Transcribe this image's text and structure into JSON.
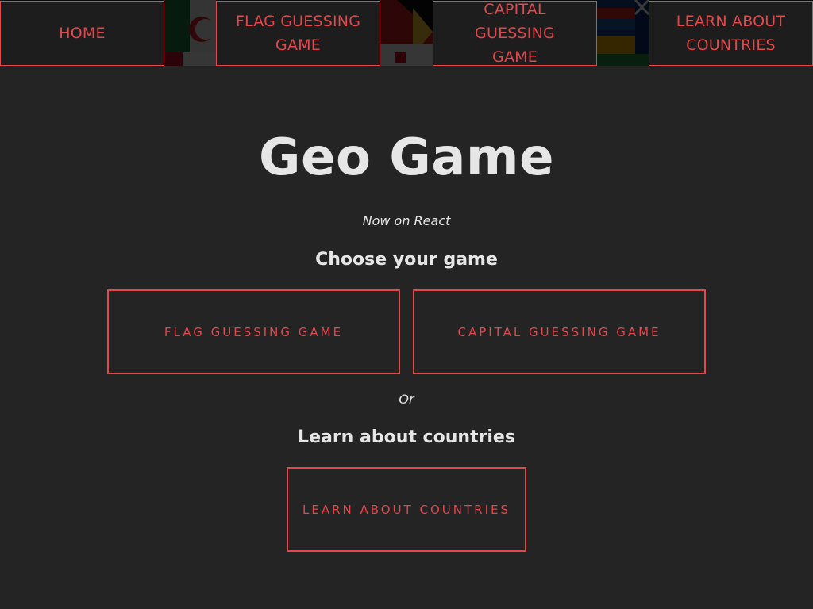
{
  "nav": {
    "home_label": "HOME",
    "flag_label_1": "FLAG GUESSING",
    "flag_label_2": "GAME",
    "capital_label_1": "CAPITAL",
    "capital_label_2": "GUESSING",
    "capital_label_3": "GAME",
    "learn_label_1": "LEARN ABOUT",
    "learn_label_2": "COUNTRIES"
  },
  "main": {
    "title": "Geo Game",
    "subtitle": "Now on React",
    "choose_heading": "Choose your game",
    "flag_button": "FLAG GUESSING GAME",
    "capital_button": "CAPITAL GUESSING GAME",
    "or_text": "Or",
    "learn_heading": "Learn about countries",
    "learn_button": "LEARN ABOUT COUNTRIES"
  },
  "colors": {
    "background": "#242424",
    "accent": "#e0484b",
    "text": "#e6e6e6",
    "nav_button_bg": "#1d1d1d"
  }
}
